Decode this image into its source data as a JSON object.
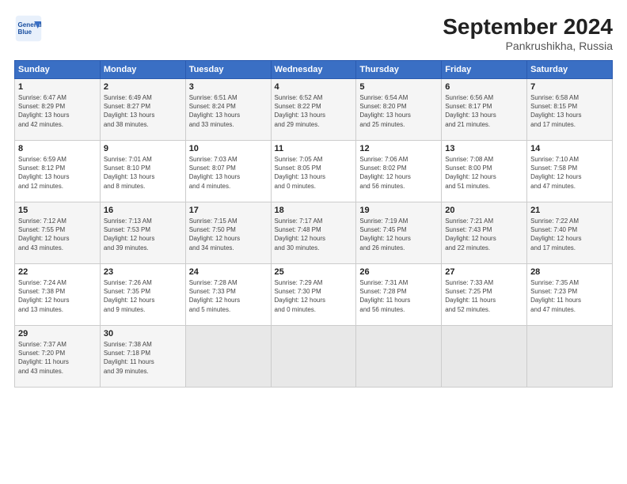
{
  "header": {
    "logo_line1": "General",
    "logo_line2": "Blue",
    "month_title": "September 2024",
    "location": "Pankrushikha, Russia"
  },
  "weekdays": [
    "Sunday",
    "Monday",
    "Tuesday",
    "Wednesday",
    "Thursday",
    "Friday",
    "Saturday"
  ],
  "weeks": [
    [
      {
        "day": "1",
        "info": "Sunrise: 6:47 AM\nSunset: 8:29 PM\nDaylight: 13 hours\nand 42 minutes."
      },
      {
        "day": "2",
        "info": "Sunrise: 6:49 AM\nSunset: 8:27 PM\nDaylight: 13 hours\nand 38 minutes."
      },
      {
        "day": "3",
        "info": "Sunrise: 6:51 AM\nSunset: 8:24 PM\nDaylight: 13 hours\nand 33 minutes."
      },
      {
        "day": "4",
        "info": "Sunrise: 6:52 AM\nSunset: 8:22 PM\nDaylight: 13 hours\nand 29 minutes."
      },
      {
        "day": "5",
        "info": "Sunrise: 6:54 AM\nSunset: 8:20 PM\nDaylight: 13 hours\nand 25 minutes."
      },
      {
        "day": "6",
        "info": "Sunrise: 6:56 AM\nSunset: 8:17 PM\nDaylight: 13 hours\nand 21 minutes."
      },
      {
        "day": "7",
        "info": "Sunrise: 6:58 AM\nSunset: 8:15 PM\nDaylight: 13 hours\nand 17 minutes."
      }
    ],
    [
      {
        "day": "8",
        "info": "Sunrise: 6:59 AM\nSunset: 8:12 PM\nDaylight: 13 hours\nand 12 minutes."
      },
      {
        "day": "9",
        "info": "Sunrise: 7:01 AM\nSunset: 8:10 PM\nDaylight: 13 hours\nand 8 minutes."
      },
      {
        "day": "10",
        "info": "Sunrise: 7:03 AM\nSunset: 8:07 PM\nDaylight: 13 hours\nand 4 minutes."
      },
      {
        "day": "11",
        "info": "Sunrise: 7:05 AM\nSunset: 8:05 PM\nDaylight: 13 hours\nand 0 minutes."
      },
      {
        "day": "12",
        "info": "Sunrise: 7:06 AM\nSunset: 8:02 PM\nDaylight: 12 hours\nand 56 minutes."
      },
      {
        "day": "13",
        "info": "Sunrise: 7:08 AM\nSunset: 8:00 PM\nDaylight: 12 hours\nand 51 minutes."
      },
      {
        "day": "14",
        "info": "Sunrise: 7:10 AM\nSunset: 7:58 PM\nDaylight: 12 hours\nand 47 minutes."
      }
    ],
    [
      {
        "day": "15",
        "info": "Sunrise: 7:12 AM\nSunset: 7:55 PM\nDaylight: 12 hours\nand 43 minutes."
      },
      {
        "day": "16",
        "info": "Sunrise: 7:13 AM\nSunset: 7:53 PM\nDaylight: 12 hours\nand 39 minutes."
      },
      {
        "day": "17",
        "info": "Sunrise: 7:15 AM\nSunset: 7:50 PM\nDaylight: 12 hours\nand 34 minutes."
      },
      {
        "day": "18",
        "info": "Sunrise: 7:17 AM\nSunset: 7:48 PM\nDaylight: 12 hours\nand 30 minutes."
      },
      {
        "day": "19",
        "info": "Sunrise: 7:19 AM\nSunset: 7:45 PM\nDaylight: 12 hours\nand 26 minutes."
      },
      {
        "day": "20",
        "info": "Sunrise: 7:21 AM\nSunset: 7:43 PM\nDaylight: 12 hours\nand 22 minutes."
      },
      {
        "day": "21",
        "info": "Sunrise: 7:22 AM\nSunset: 7:40 PM\nDaylight: 12 hours\nand 17 minutes."
      }
    ],
    [
      {
        "day": "22",
        "info": "Sunrise: 7:24 AM\nSunset: 7:38 PM\nDaylight: 12 hours\nand 13 minutes."
      },
      {
        "day": "23",
        "info": "Sunrise: 7:26 AM\nSunset: 7:35 PM\nDaylight: 12 hours\nand 9 minutes."
      },
      {
        "day": "24",
        "info": "Sunrise: 7:28 AM\nSunset: 7:33 PM\nDaylight: 12 hours\nand 5 minutes."
      },
      {
        "day": "25",
        "info": "Sunrise: 7:29 AM\nSunset: 7:30 PM\nDaylight: 12 hours\nand 0 minutes."
      },
      {
        "day": "26",
        "info": "Sunrise: 7:31 AM\nSunset: 7:28 PM\nDaylight: 11 hours\nand 56 minutes."
      },
      {
        "day": "27",
        "info": "Sunrise: 7:33 AM\nSunset: 7:25 PM\nDaylight: 11 hours\nand 52 minutes."
      },
      {
        "day": "28",
        "info": "Sunrise: 7:35 AM\nSunset: 7:23 PM\nDaylight: 11 hours\nand 47 minutes."
      }
    ],
    [
      {
        "day": "29",
        "info": "Sunrise: 7:37 AM\nSunset: 7:20 PM\nDaylight: 11 hours\nand 43 minutes."
      },
      {
        "day": "30",
        "info": "Sunrise: 7:38 AM\nSunset: 7:18 PM\nDaylight: 11 hours\nand 39 minutes."
      },
      {
        "day": "",
        "info": ""
      },
      {
        "day": "",
        "info": ""
      },
      {
        "day": "",
        "info": ""
      },
      {
        "day": "",
        "info": ""
      },
      {
        "day": "",
        "info": ""
      }
    ]
  ]
}
